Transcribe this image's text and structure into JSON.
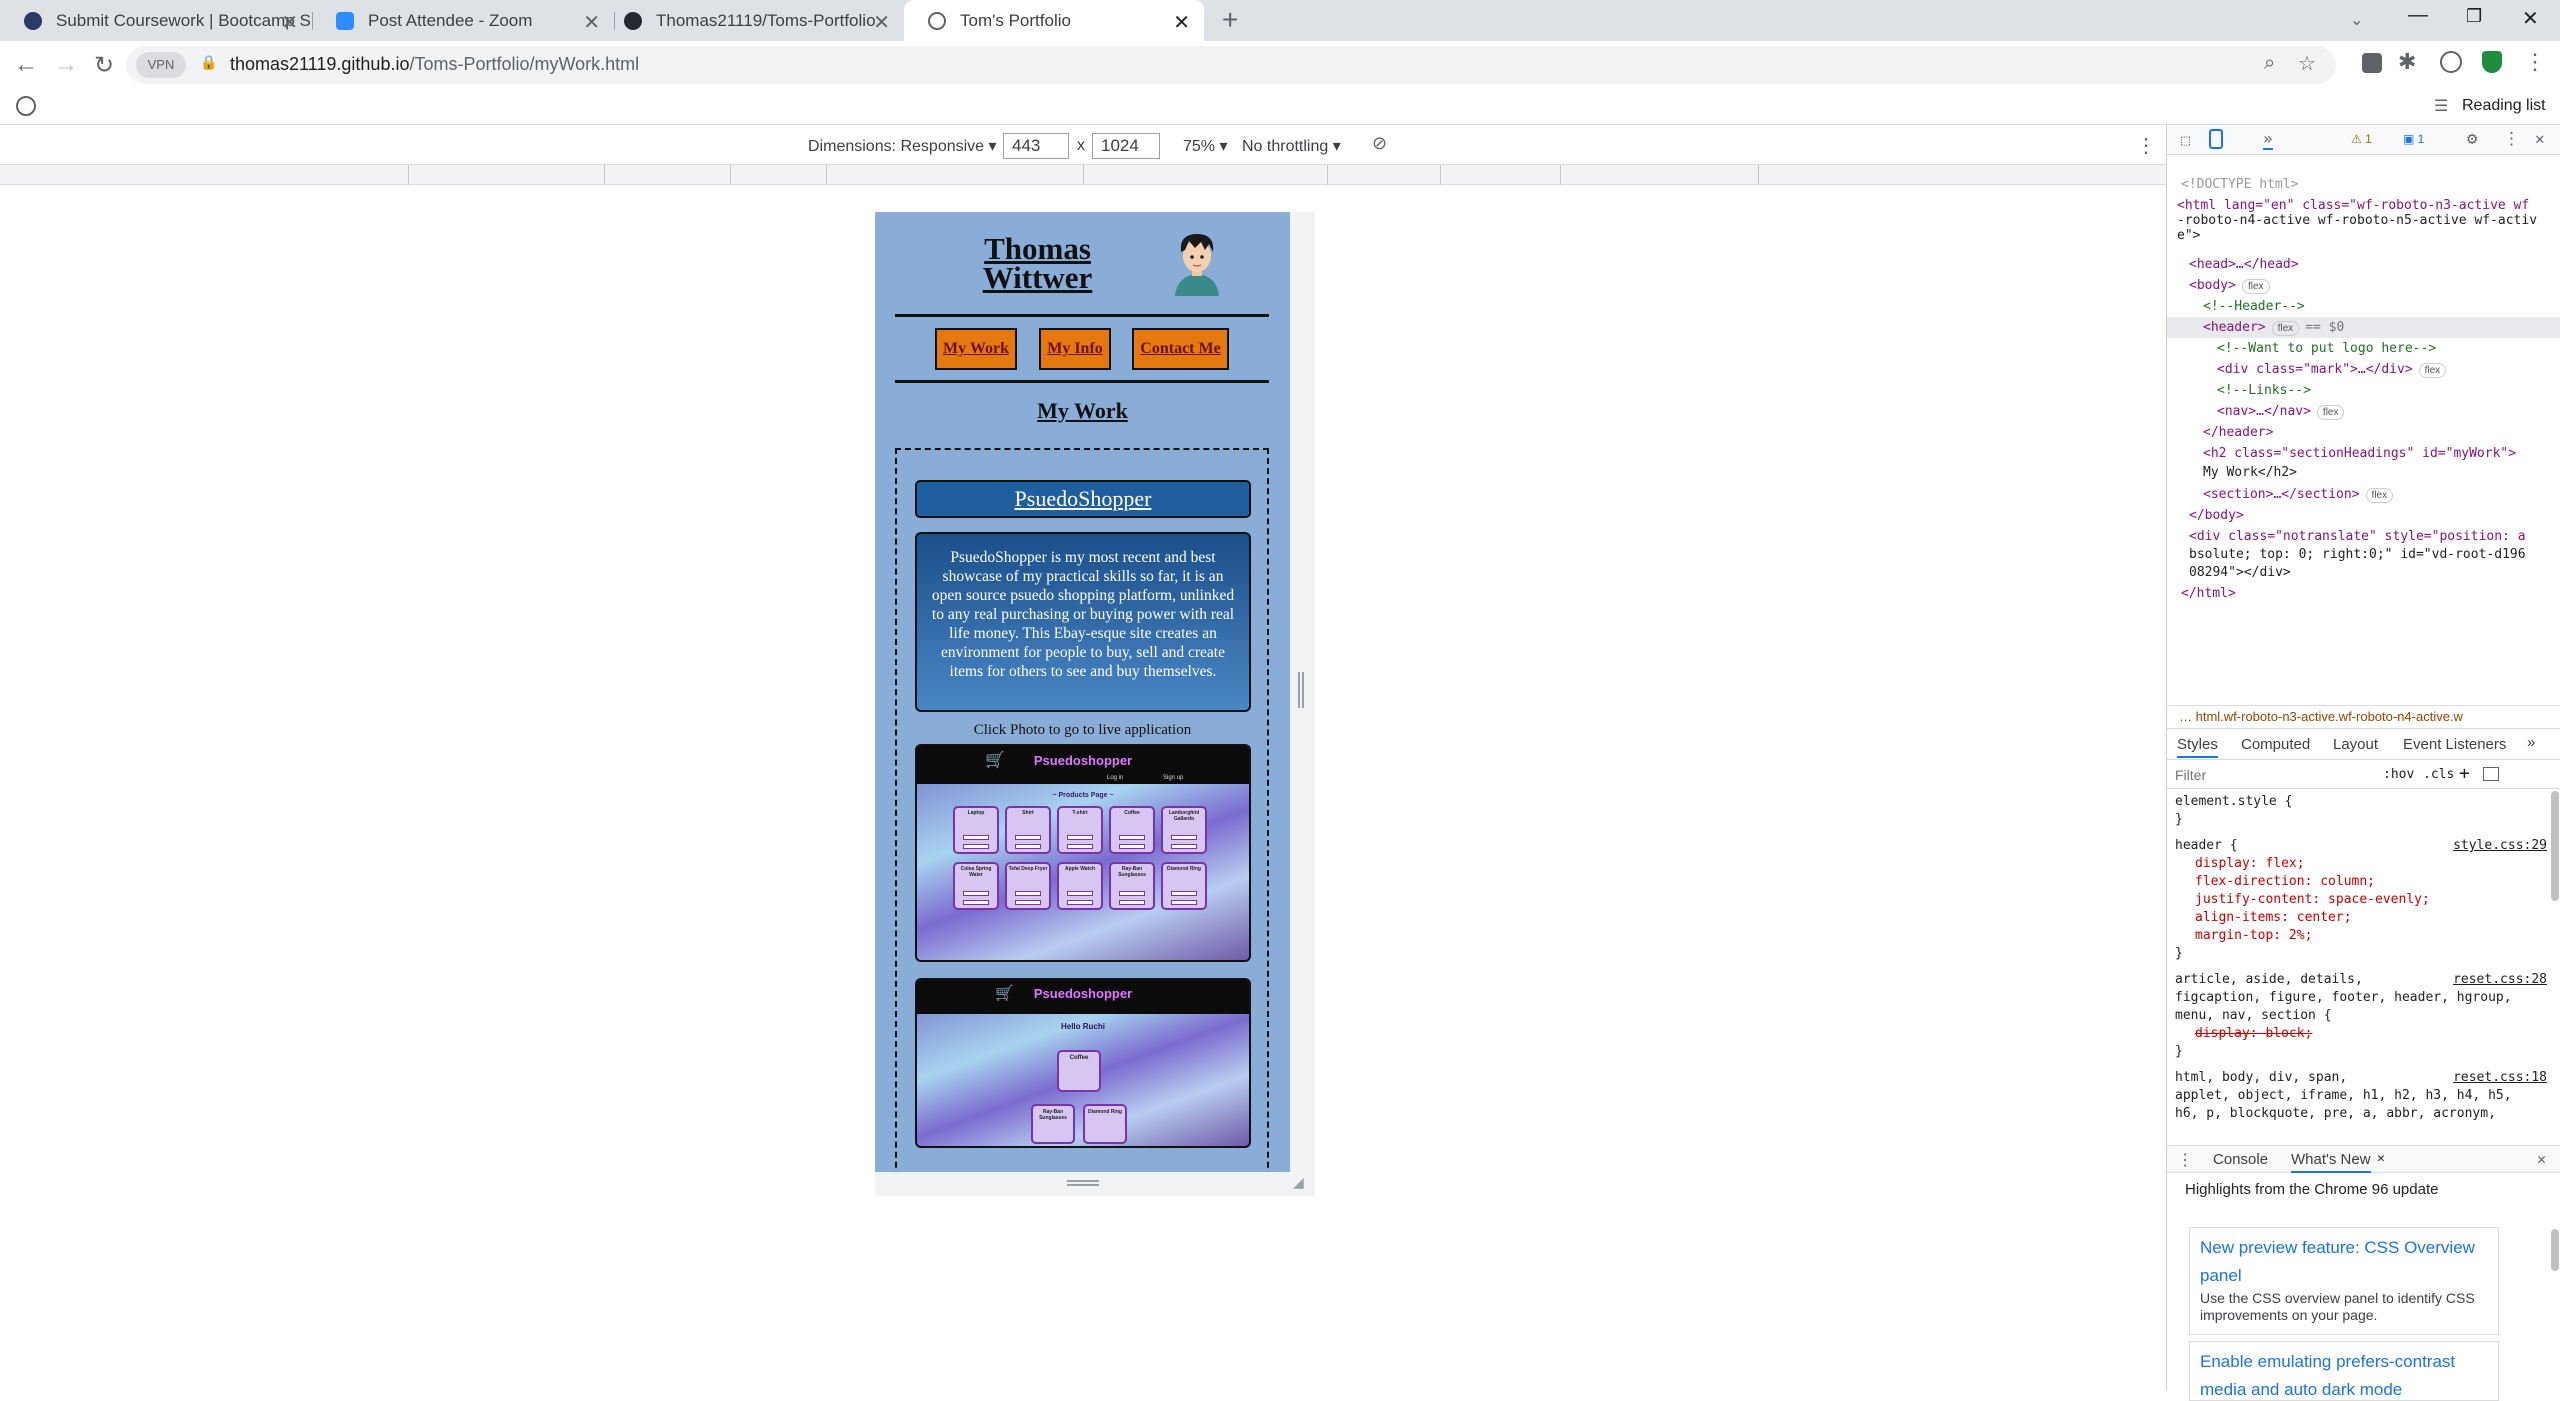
{
  "tabs": [
    {
      "title": "Submit Coursework | Bootcamp S",
      "favicon": "bootcamp-icon"
    },
    {
      "title": "Post Attendee - Zoom",
      "favicon": "zoom-icon"
    },
    {
      "title": "Thomas21119/Toms-Portfolio",
      "favicon": "github-icon"
    },
    {
      "title": "Tom's Portfolio",
      "favicon": "globe-icon"
    }
  ],
  "address": {
    "host": "thomas21119.github.io",
    "path": "/Toms-Portfolio/myWork.html",
    "vpn_label": "VPN"
  },
  "reading_list": "Reading list",
  "device_toolbar": {
    "dimensions_label": "Dimensions: Responsive",
    "width": "443",
    "times": "x",
    "height": "1024",
    "zoom": "75%",
    "throttling": "No throttling"
  },
  "page": {
    "name_line1": "Thomas",
    "name_line2": "Wittwer",
    "nav": [
      "My Work",
      "My Info",
      "Contact Me"
    ],
    "section_heading": "My Work",
    "project_title": "PsuedoShopper",
    "project_description": "PsuedoShopper is my most recent and best showcase of my practical skills so far, it is an open source psuedo shopping platform, unlinked to any real purchasing or buying power with real life money. This Ebay-esque site creates an environment for people to buy, sell and create items for others to see and buy themselves.",
    "click_note": "Click Photo to go to live application",
    "screenshot1": {
      "brand": "Psuedoshopper",
      "nav_left": "Log in",
      "nav_right": "Sign up",
      "section": "~ Products Page ~",
      "products": [
        "Laptop",
        "Shirt",
        "T-shirt",
        "Coffee",
        "Lamborghini Gallardo",
        "Colea Spring Water",
        "Tefal Deep Fryer",
        "Apple Watch",
        "Ray-Ban Sunglasses",
        "Diamond Ring"
      ]
    },
    "screenshot2": {
      "brand": "Psuedoshopper",
      "greeting": "Hello Ruchi",
      "items": [
        "Coffee",
        "Ray-Ban Sunglasses",
        "Diamond Ring"
      ]
    }
  },
  "devtools": {
    "warnings": "1",
    "messages": "1",
    "dom": [
      {
        "text": "<!DOCTYPE html>"
      },
      {
        "text": "<html lang=\"en\" class=\"wf-roboto-n3-active wf"
      },
      {
        "text": "-roboto-n4-active wf-roboto-n5-active wf-activ"
      },
      {
        "text": "e\">"
      },
      {
        "text": "<head>…</head>"
      },
      {
        "text": "<body>"
      },
      {
        "text": "<!--Header-->"
      },
      {
        "text": "<header>"
      },
      {
        "text": "<!--Want to put logo here-->"
      },
      {
        "text": "<div class=\"mark\">…</div>"
      },
      {
        "text": "<!--Links-->"
      },
      {
        "text": "<nav>…</nav>"
      },
      {
        "text": "</header>"
      },
      {
        "text": "<h2 class=\"sectionHeadings\" id=\"myWork\">"
      },
      {
        "text": "My Work</h2>"
      },
      {
        "text": "<section>…</section>"
      },
      {
        "text": "</body>"
      },
      {
        "text": "<div class=\"notranslate\" style=\"position: a"
      },
      {
        "text": "bsolute; top: 0; right:0;\" id=\"vd-root-d196"
      },
      {
        "text": "08294\"></div>"
      },
      {
        "text": "</html>"
      }
    ],
    "flex_label": "flex",
    "selected_marker": "== $0",
    "breadcrumb": "html.wf-roboto-n3-active.wf-roboto-n4-active.w",
    "style_tabs": [
      "Styles",
      "Computed",
      "Layout",
      "Event Listeners"
    ],
    "filter_placeholder": "Filter",
    "hov": ":hov",
    "cls": ".cls",
    "css": [
      {
        "text": "element.style {"
      },
      {
        "text": "}"
      },
      {
        "text": "header {",
        "source": "style.css:29"
      },
      {
        "text": "display: flex;"
      },
      {
        "text": "flex-direction: column;"
      },
      {
        "text": "justify-content: space-evenly;"
      },
      {
        "text": "align-items: center;"
      },
      {
        "text": "margin-top: 2%;"
      },
      {
        "text": "}"
      },
      {
        "text": "article, aside, details,",
        "source": "reset.css:28"
      },
      {
        "text": "figcaption, figure, footer, header, hgroup,"
      },
      {
        "text": "menu, nav, section {"
      },
      {
        "text": "display: block;"
      },
      {
        "text": "}"
      },
      {
        "text": "html, body, div, span,",
        "source": "reset.css:18"
      },
      {
        "text": "applet, object, iframe, h1, h2, h3, h4, h5,"
      },
      {
        "text": "h6, p, blockquote, pre, a, abbr, acronym,"
      }
    ],
    "drawer_tabs": [
      "Console",
      "What's New"
    ],
    "whats_new_title": "Highlights from the Chrome 96 update",
    "cards": [
      {
        "title": "New preview feature: CSS Overview panel",
        "body": "Use the CSS overview panel to identify CSS improvements on your page."
      },
      {
        "title": "Enable emulating prefers-contrast media and auto dark mode",
        "body": ""
      }
    ]
  }
}
